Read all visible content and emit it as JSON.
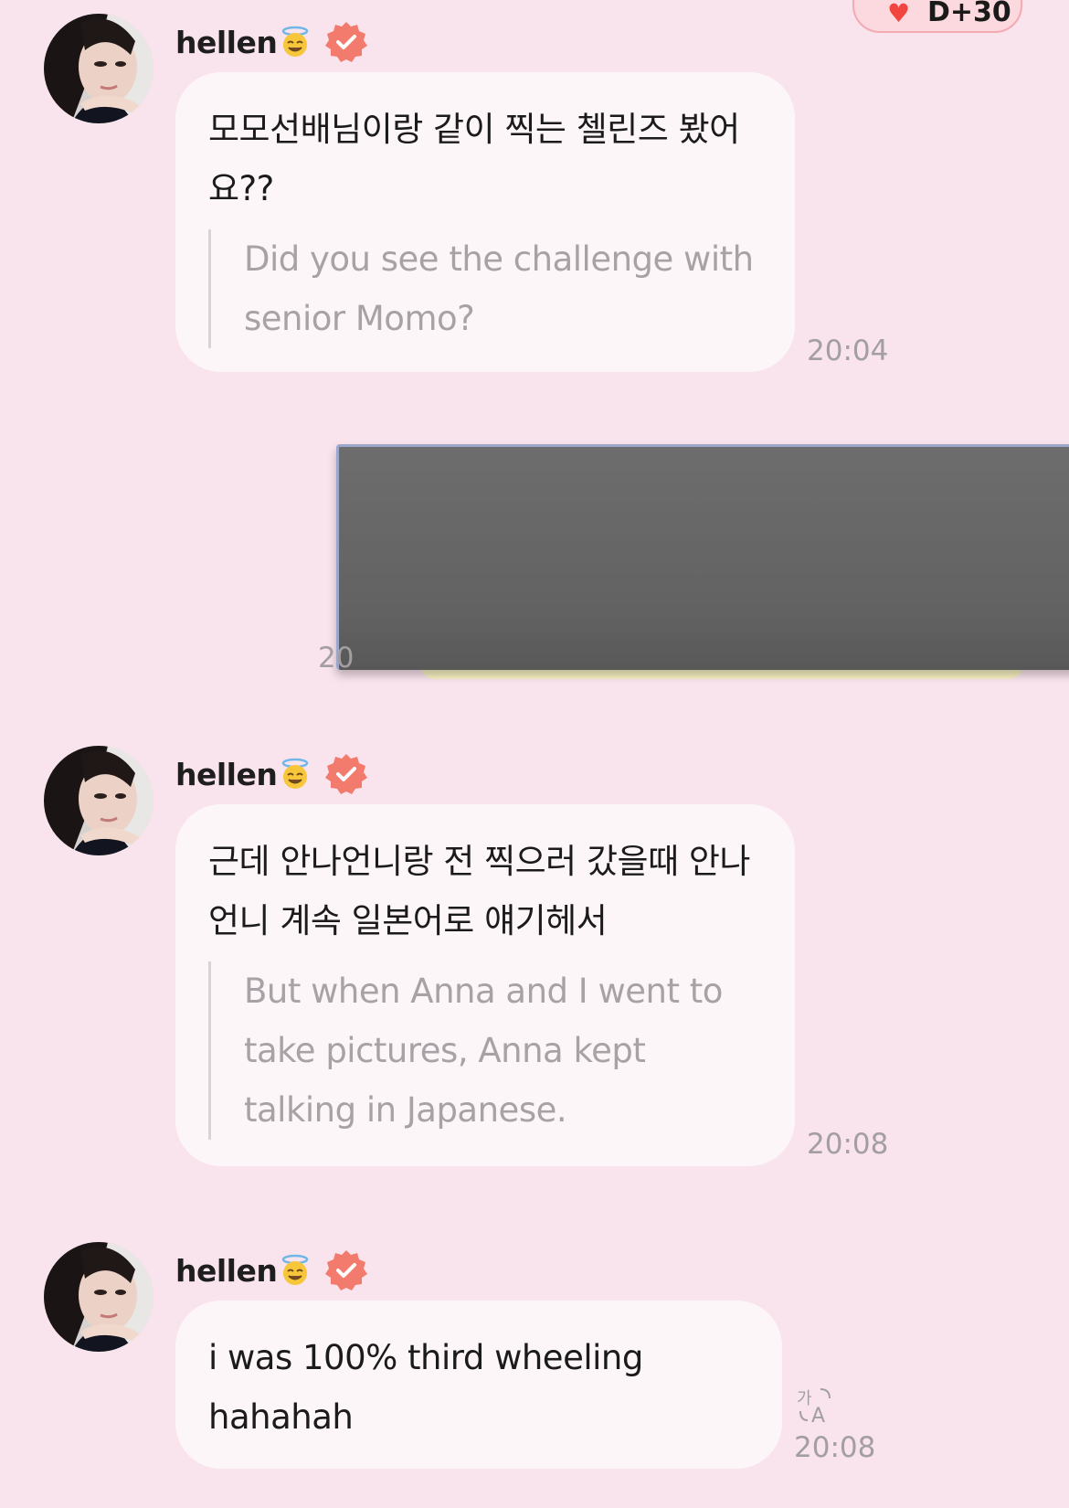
{
  "header": {
    "badge_text": "D+30"
  },
  "messages": [
    {
      "sender": "hellen",
      "original": "모모선배님이랑 같이 찍는 첼린즈 봤어요??",
      "translation": "Did you see the challenge with senior Momo?",
      "time": "20:04"
    },
    {
      "sender_self": true,
      "time_partial": "20"
    },
    {
      "sender": "hellen",
      "original": "근데 안나언니랑 전 찍으러 갔을때 안나언니 계속 일본어로 얘기헤서",
      "translation": "But when Anna and I went to take pictures, Anna kept talking in Japanese.",
      "time": "20:08"
    },
    {
      "sender": "hellen",
      "original": "i was 100% third wheeling hahahah",
      "time": "20:08"
    }
  ],
  "colors": {
    "background": "#f9e4ed",
    "bubble": "#fdf6f8",
    "verified": "#f37b6e",
    "translation_text": "#a7a2a5"
  },
  "icons": {
    "verified": "verified-badge-icon",
    "emoji": "angel-halo-emoji-icon",
    "translate": "translate-icon",
    "heart": "heart-icon"
  }
}
